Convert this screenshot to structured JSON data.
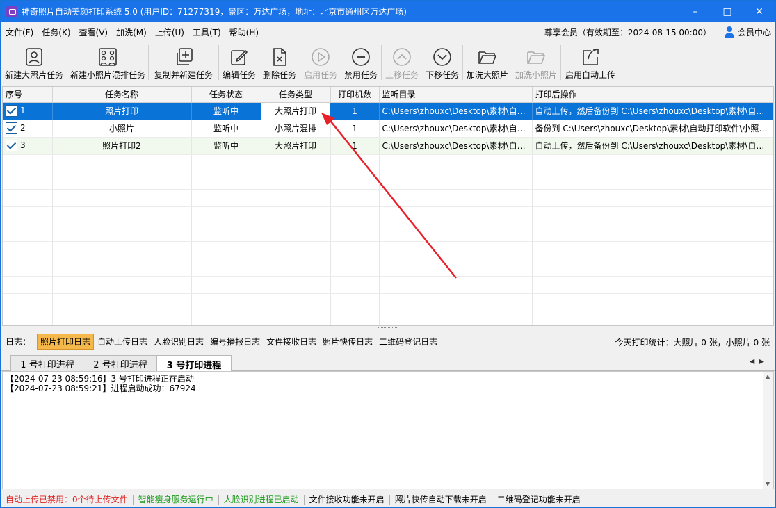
{
  "window": {
    "title": "神奇照片自动美颜打印系统 5.0 (用户ID：71277319，景区：万达广场，地址：北京市通州区万达广场)",
    "min_icon": "minimize-icon",
    "max_icon": "maximize-icon",
    "close_icon": "close-icon"
  },
  "menu": {
    "items": [
      "文件(F)",
      "任务(K)",
      "查看(V)",
      "加洗(M)",
      "上传(U)",
      "工具(T)",
      "帮助(H)"
    ],
    "vip_text": "尊享会员（有效期至：2024-08-15 00:00）",
    "member_label": "会员中心"
  },
  "toolbar": {
    "new_big": "新建大照片任务",
    "new_small": "新建小照片混排任务",
    "copy_new": "复制并新建任务",
    "edit": "编辑任务",
    "delete": "删除任务",
    "enable": "启用任务",
    "disable": "禁用任务",
    "move_up": "上移任务",
    "move_down": "下移任务",
    "reprint_big": "加洗大照片",
    "reprint_small": "加洗小照片",
    "auto_upload": "启用自动上传"
  },
  "grid": {
    "headers": [
      "序号",
      "任务名称",
      "任务状态",
      "任务类型",
      "打印机数",
      "监听目录",
      "打印后操作"
    ],
    "rows": [
      {
        "no": "1",
        "name": "照片打印",
        "status": "监听中",
        "type": "大照片打印",
        "printers": "1",
        "dir": "C:\\Users\\zhouxc\\Desktop\\素材\\自动...",
        "after": "自动上传，然后备份到 C:\\Users\\zhouxc\\Desktop\\素材\\自动..."
      },
      {
        "no": "2",
        "name": "小照片",
        "status": "监听中",
        "type": "小照片混排",
        "printers": "1",
        "dir": "C:\\Users\\zhouxc\\Desktop\\素材\\自动...",
        "after": "备份到 C:\\Users\\zhouxc\\Desktop\\素材\\自动打印软件\\小照片..."
      },
      {
        "no": "3",
        "name": "照片打印2",
        "status": "监听中",
        "type": "大照片打印",
        "printers": "1",
        "dir": "C:\\Users\\zhouxc\\Desktop\\素材\\自动...",
        "after": "自动上传，然后备份到 C:\\Users\\zhouxc\\Desktop\\素材\\自动..."
      }
    ]
  },
  "logbar": {
    "label": "日志：",
    "tabs": [
      "照片打印日志",
      "自动上传日志",
      "人脸识别日志",
      "编号播报日志",
      "文件接收日志",
      "照片快传日志",
      "二维码登记日志"
    ],
    "stats": "今天打印统计：大照片 0 张，小照片 0 张"
  },
  "process_tabs": [
    "1 号打印进程",
    "2 号打印进程",
    "3 号打印进程"
  ],
  "log_lines": [
    "【2024-07-23 08:59:16】3 号打印进程正在启动",
    "【2024-07-23 08:59:21】进程启动成功：67924"
  ],
  "status": {
    "upload": "自动上传已禁用：0个待上传文件",
    "beauty": "智能瘦身服务运行中",
    "face": "人脸识别进程已启动",
    "file_recv": "文件接收功能未开启",
    "quick": "照片快传自动下载未开启",
    "qrcode": "二维码登记功能未开启",
    "red_color": "#e02020",
    "green_color": "#1a9a1a"
  }
}
